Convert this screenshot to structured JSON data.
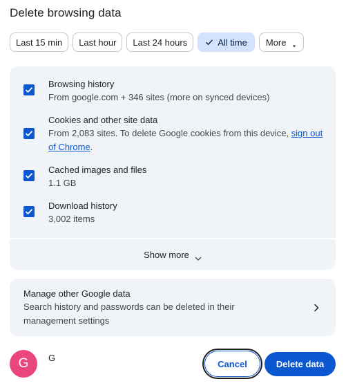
{
  "dialog": {
    "title": "Delete browsing data"
  },
  "time_range": {
    "chips": [
      {
        "label": "Last 15 min",
        "selected": false
      },
      {
        "label": "Last hour",
        "selected": false
      },
      {
        "label": "Last 24 hours",
        "selected": false
      },
      {
        "label": "All time",
        "selected": true
      },
      {
        "label": "More",
        "selected": false
      }
    ]
  },
  "data_types": {
    "items": [
      {
        "title": "Browsing history",
        "subtitle": "From google.com + 346 sites (more on synced devices)",
        "checked": true
      },
      {
        "title": "Cookies and other site data",
        "subtitle": "From 2,083 sites. To delete Google cookies from this device,",
        "link": "sign out of Chrome",
        "subtitle_end": ".",
        "checked": true
      },
      {
        "title": "Cached images and files",
        "subtitle": "1.1 GB",
        "checked": true
      },
      {
        "title": "Download history",
        "subtitle": "3,002 items",
        "checked": true
      }
    ],
    "show_more_label": "Show more"
  },
  "manage": {
    "title": "Manage other Google data",
    "subtitle": "Search history and passwords can be deleted in their management settings"
  },
  "footer": {
    "avatar_letter": "G",
    "account_name": "G",
    "cancel_label": "Cancel",
    "delete_label": "Delete data"
  },
  "colors": {
    "accent": "#0b57d0",
    "selected_chip_bg": "#d3e3fd",
    "panel_bg": "#f0f4f9",
    "avatar_bg": "#e8467c"
  }
}
